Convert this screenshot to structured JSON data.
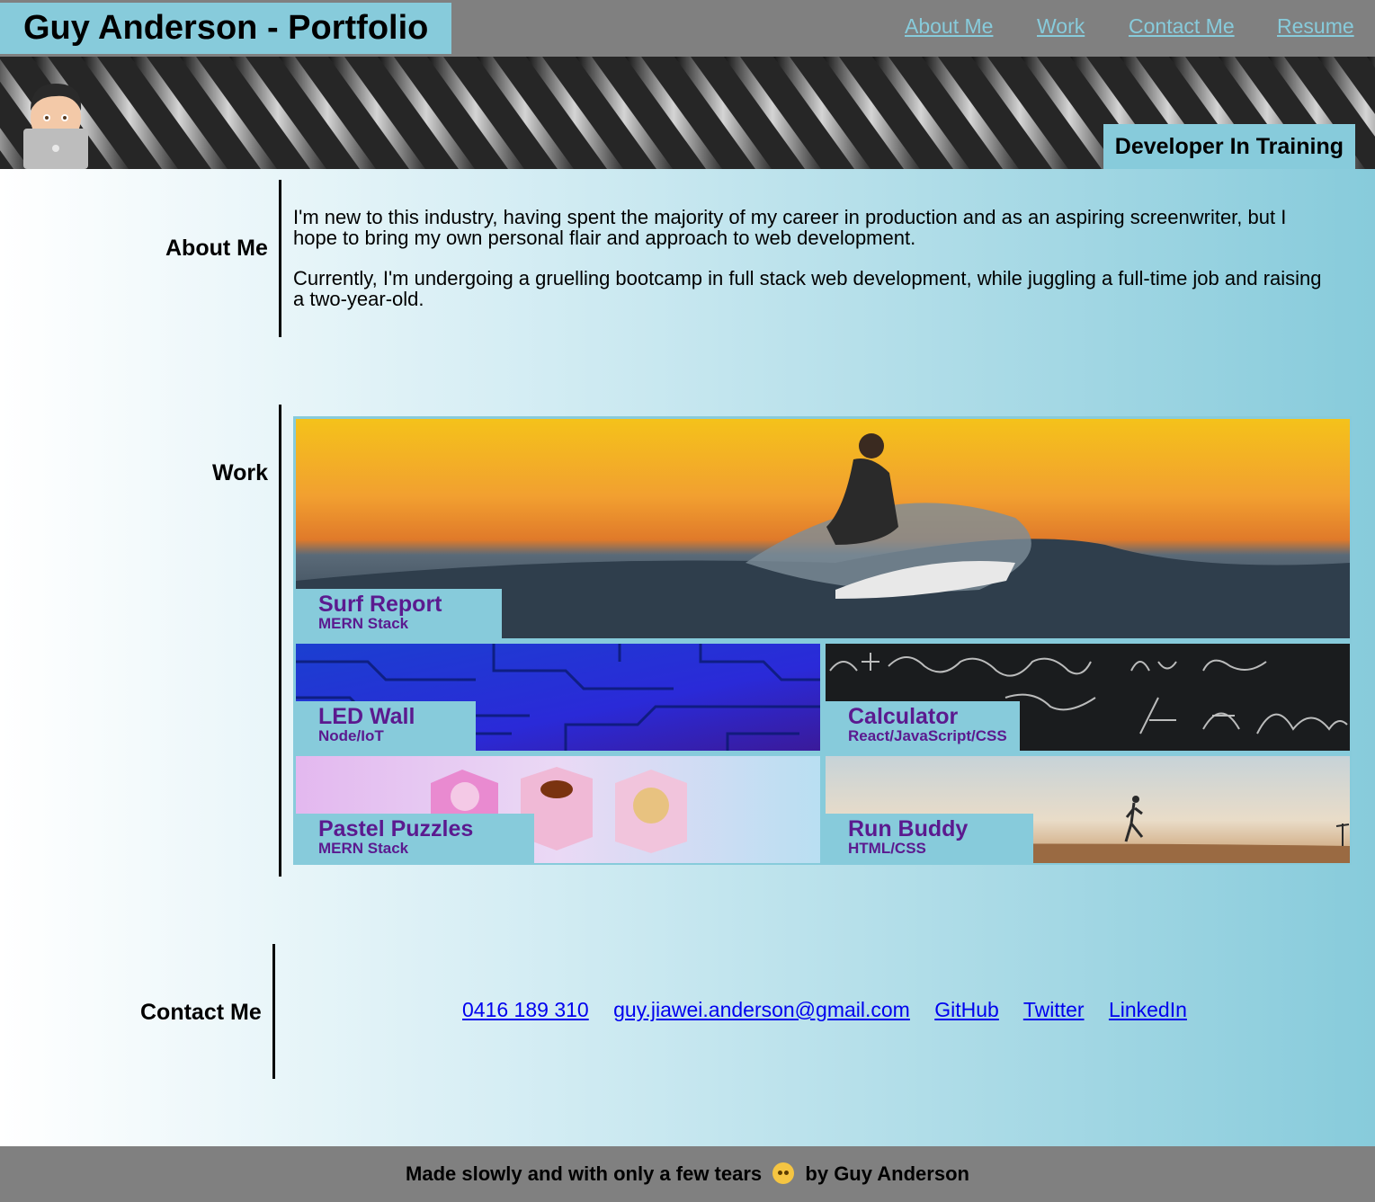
{
  "header": {
    "title": "Guy Anderson - Portfolio",
    "nav": [
      "About Me",
      "Work",
      "Contact Me",
      "Resume"
    ]
  },
  "hero": {
    "tagline": "Developer In Training",
    "avatar_icon": "memoji-laptop-icon"
  },
  "about": {
    "heading": "About Me",
    "paragraphs": [
      "I'm new to this industry, having spent the majority of my career in production and as an aspiring screenwriter, but I hope to bring my own personal flair and approach to web development.",
      "Currently, I'm undergoing a gruelling bootcamp in full stack web development, while juggling a full-time job and raising a two-year-old."
    ]
  },
  "work": {
    "heading": "Work",
    "projects": [
      {
        "title": "Surf Report",
        "stack": "MERN Stack",
        "image": "surfer-sunset"
      },
      {
        "title": "LED Wall",
        "stack": "Node/IoT",
        "image": "blue-circuit-board"
      },
      {
        "title": "Calculator",
        "stack": "React/JavaScript/CSS",
        "image": "chalkboard-math"
      },
      {
        "title": "Pastel Puzzles",
        "stack": "MERN Stack",
        "image": "pastel-cubes"
      },
      {
        "title": "Run Buddy",
        "stack": "HTML/CSS",
        "image": "runner-desert"
      }
    ]
  },
  "contact": {
    "heading": "Contact Me",
    "links": [
      "0416 189 310",
      "guy.jiawei.anderson@gmail.com",
      "GitHub",
      "Twitter",
      "LinkedIn"
    ]
  },
  "footer": {
    "before": "Made slowly and with only a few tears",
    "emoji": "flushed-face-icon",
    "after": "by Guy Anderson"
  },
  "colors": {
    "accent": "#87CBDB",
    "bar": "#808080",
    "card_text": "#5b1a8f",
    "link": "#0000ee"
  }
}
